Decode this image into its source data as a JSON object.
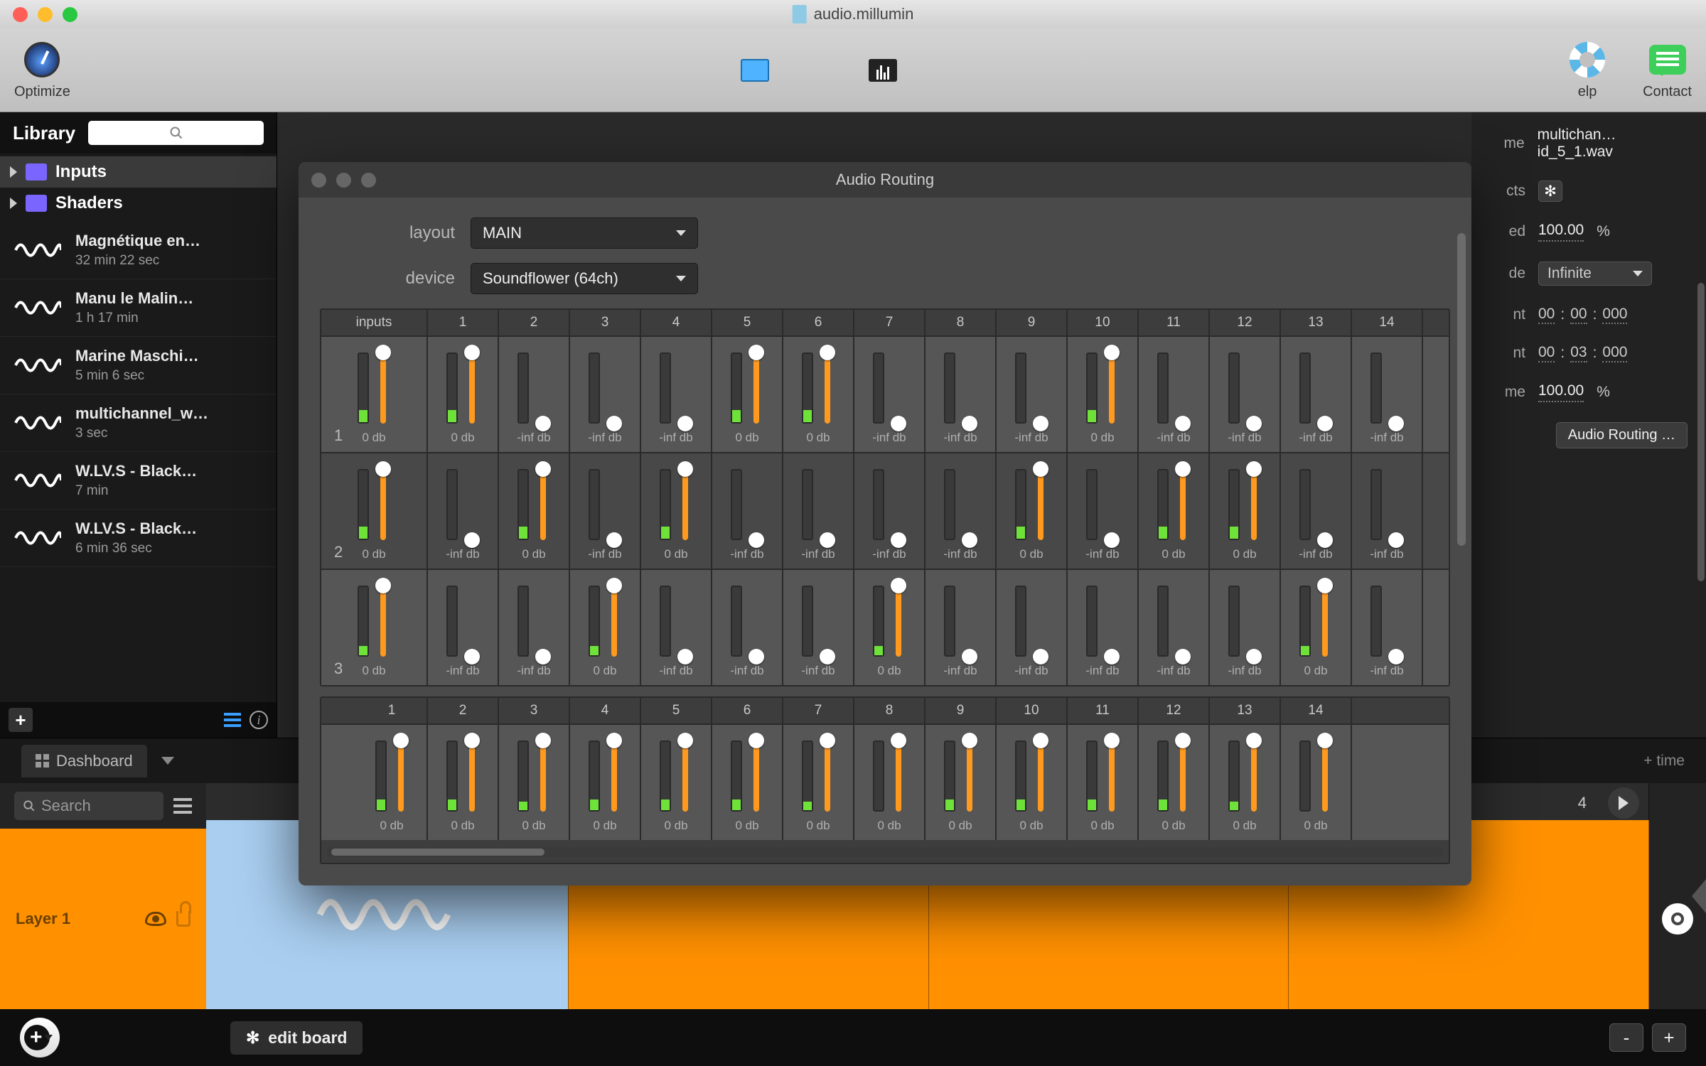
{
  "window": {
    "title": "audio.millumin"
  },
  "toolbar": {
    "optimize": "Optimize",
    "help": "elp",
    "contact": "Contact"
  },
  "library": {
    "title": "Library",
    "folders": [
      {
        "name": "Inputs"
      },
      {
        "name": "Shaders"
      }
    ],
    "items": [
      {
        "title": "Magnétique en…",
        "duration": "32 min 22 sec"
      },
      {
        "title": "Manu le Malin…",
        "duration": "1 h  17 min"
      },
      {
        "title": "Marine Maschi…",
        "duration": "5 min 6 sec"
      },
      {
        "title": "multichannel_w…",
        "duration": "3 sec"
      },
      {
        "title": "W.LV.S - Black…",
        "duration": "7 min"
      },
      {
        "title": "W.LV.S - Black…",
        "duration": "6 min 36 sec"
      }
    ]
  },
  "tabs": {
    "dashboard": "Dashboard",
    "add_time": "+ time"
  },
  "board": {
    "search_placeholder": "Search",
    "layer": "Layer 1",
    "edit": "edit board",
    "col_visible_last": "4"
  },
  "props": {
    "name_lab": "me",
    "name_val": "multichan…id_5_1.wav",
    "effects_lab": "cts",
    "speed_lab": "ed",
    "speed_val": "100.00",
    "speed_unit": "%",
    "mode_lab": "de",
    "mode_val": "Infinite",
    "in_lab": "nt",
    "out_lab": "nt",
    "tc_in": {
      "h": "00",
      "m": "00",
      "ms": "000"
    },
    "tc_out": {
      "h": "00",
      "m": "03",
      "ms": "000"
    },
    "vol_lab": "me",
    "vol_val": "100.00",
    "vol_unit": "%",
    "routing_btn": "Audio Routing …"
  },
  "modal": {
    "title": "Audio Routing",
    "layout_label": "layout",
    "layout_value": "MAIN",
    "device_label": "device",
    "device_value": "Soundflower (64ch)",
    "inputs_label": "inputs",
    "channels": [
      "1",
      "2",
      "3",
      "4",
      "5",
      "6",
      "7",
      "8",
      "9",
      "10",
      "11",
      "12",
      "13",
      "14"
    ],
    "rows": [
      {
        "num": "1",
        "input": {
          "meter": 18,
          "fader": 100,
          "db": "0 db"
        },
        "cells": [
          {
            "meter": 18,
            "fader": 100,
            "db": "0 db"
          },
          {
            "meter": 0,
            "fader": 0,
            "db": "-inf db"
          },
          {
            "meter": 0,
            "fader": 0,
            "db": "-inf db"
          },
          {
            "meter": 0,
            "fader": 0,
            "db": "-inf db"
          },
          {
            "meter": 18,
            "fader": 100,
            "db": "0 db"
          },
          {
            "meter": 18,
            "fader": 100,
            "db": "0 db"
          },
          {
            "meter": 0,
            "fader": 0,
            "db": "-inf db"
          },
          {
            "meter": 0,
            "fader": 0,
            "db": "-inf db"
          },
          {
            "meter": 0,
            "fader": 0,
            "db": "-inf db"
          },
          {
            "meter": 18,
            "fader": 100,
            "db": "0 db"
          },
          {
            "meter": 0,
            "fader": 0,
            "db": "-inf db"
          },
          {
            "meter": 0,
            "fader": 0,
            "db": "-inf db"
          },
          {
            "meter": 0,
            "fader": 0,
            "db": "-inf db"
          },
          {
            "meter": 0,
            "fader": 0,
            "db": "-inf db"
          }
        ]
      },
      {
        "num": "2",
        "input": {
          "meter": 18,
          "fader": 100,
          "db": "0 db"
        },
        "cells": [
          {
            "meter": 0,
            "fader": 0,
            "db": "-inf db"
          },
          {
            "meter": 18,
            "fader": 100,
            "db": "0 db"
          },
          {
            "meter": 0,
            "fader": 0,
            "db": "-inf db"
          },
          {
            "meter": 18,
            "fader": 100,
            "db": "0 db"
          },
          {
            "meter": 0,
            "fader": 0,
            "db": "-inf db"
          },
          {
            "meter": 0,
            "fader": 0,
            "db": "-inf db"
          },
          {
            "meter": 0,
            "fader": 0,
            "db": "-inf db"
          },
          {
            "meter": 0,
            "fader": 0,
            "db": "-inf db"
          },
          {
            "meter": 18,
            "fader": 100,
            "db": "0 db"
          },
          {
            "meter": 0,
            "fader": 0,
            "db": "-inf db"
          },
          {
            "meter": 18,
            "fader": 100,
            "db": "0 db"
          },
          {
            "meter": 18,
            "fader": 100,
            "db": "0 db"
          },
          {
            "meter": 0,
            "fader": 0,
            "db": "-inf db"
          },
          {
            "meter": 0,
            "fader": 0,
            "db": "-inf db"
          }
        ]
      },
      {
        "num": "3",
        "input": {
          "meter": 14,
          "fader": 100,
          "db": "0 db"
        },
        "cells": [
          {
            "meter": 0,
            "fader": 0,
            "db": "-inf db"
          },
          {
            "meter": 0,
            "fader": 0,
            "db": "-inf db"
          },
          {
            "meter": 14,
            "fader": 100,
            "db": "0 db"
          },
          {
            "meter": 0,
            "fader": 0,
            "db": "-inf db"
          },
          {
            "meter": 0,
            "fader": 0,
            "db": "-inf db"
          },
          {
            "meter": 0,
            "fader": 0,
            "db": "-inf db"
          },
          {
            "meter": 14,
            "fader": 100,
            "db": "0 db"
          },
          {
            "meter": 0,
            "fader": 0,
            "db": "-inf db"
          },
          {
            "meter": 0,
            "fader": 0,
            "db": "-inf db"
          },
          {
            "meter": 0,
            "fader": 0,
            "db": "-inf db"
          },
          {
            "meter": 0,
            "fader": 0,
            "db": "-inf db"
          },
          {
            "meter": 0,
            "fader": 0,
            "db": "-inf db"
          },
          {
            "meter": 14,
            "fader": 100,
            "db": "0 db"
          },
          {
            "meter": 0,
            "fader": 0,
            "db": "-inf db"
          }
        ]
      }
    ],
    "outputs": [
      {
        "meter": 16,
        "fader": 100,
        "db": "0 db"
      },
      {
        "meter": 16,
        "fader": 100,
        "db": "0 db"
      },
      {
        "meter": 13,
        "fader": 100,
        "db": "0 db"
      },
      {
        "meter": 16,
        "fader": 100,
        "db": "0 db"
      },
      {
        "meter": 16,
        "fader": 100,
        "db": "0 db"
      },
      {
        "meter": 16,
        "fader": 100,
        "db": "0 db"
      },
      {
        "meter": 13,
        "fader": 100,
        "db": "0 db"
      },
      {
        "meter": 0,
        "fader": 100,
        "db": "0 db"
      },
      {
        "meter": 16,
        "fader": 100,
        "db": "0 db"
      },
      {
        "meter": 16,
        "fader": 100,
        "db": "0 db"
      },
      {
        "meter": 16,
        "fader": 100,
        "db": "0 db"
      },
      {
        "meter": 16,
        "fader": 100,
        "db": "0 db"
      },
      {
        "meter": 13,
        "fader": 100,
        "db": "0 db"
      },
      {
        "meter": 0,
        "fader": 100,
        "db": "0 db"
      }
    ]
  }
}
